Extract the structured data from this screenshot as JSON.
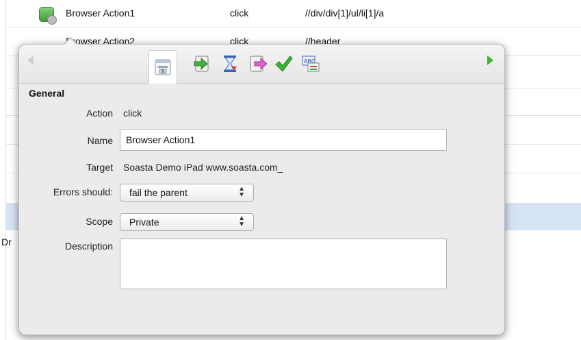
{
  "table": {
    "row0": {
      "name": "Browser Action1",
      "action": "click",
      "target": "//div/div[1]/ul/li[1]/a"
    },
    "row1": {
      "name": "Browser Action2",
      "action": "click",
      "target": "//header"
    },
    "dr_text": "Dr"
  },
  "toolbar": {
    "icons": [
      "properties-icon",
      "input-icon",
      "waits-icon",
      "output-icon",
      "validations-icon",
      "locator-icon"
    ],
    "selected": "properties-icon"
  },
  "general": {
    "title": "General",
    "action_label": "Action",
    "action_value": "click",
    "name_label": "Name",
    "name_value": "Browser Action1",
    "target_label": "Target",
    "target_value": "Soasta Demo iPad www.soasta.com_",
    "errors_label": "Errors should:",
    "errors_value": "fail the parent",
    "scope_label": "Scope",
    "scope_value": "Private",
    "description_label": "Description",
    "description_value": ""
  },
  "colors": {
    "selected_row": "#d5e3f4",
    "nav_arrow_active": "#39b52a",
    "panel_bg": "#ebebeb"
  }
}
